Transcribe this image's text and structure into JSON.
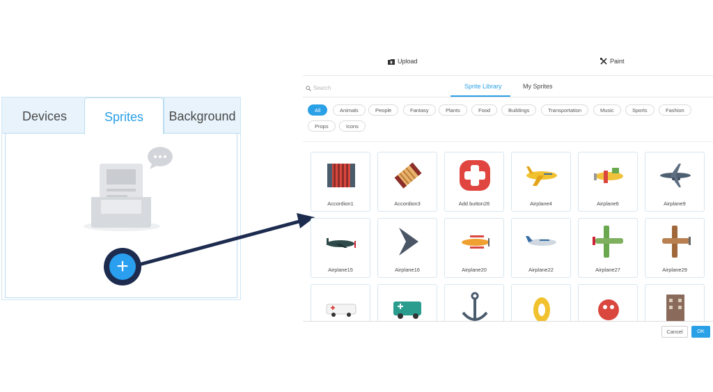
{
  "left_panel": {
    "tabs": [
      "Devices",
      "Sprites",
      "Background"
    ],
    "add_symbol": "+"
  },
  "dialog": {
    "upload_label": "Upload",
    "paint_label": "Paint",
    "search_placeholder": "Search",
    "library_tab": "Sprite Library",
    "my_tab": "My Sprites",
    "categories": [
      "All",
      "Animals",
      "People",
      "Fantasy",
      "Plants",
      "Food",
      "Buildings",
      "Transportation",
      "Music",
      "Sports",
      "Fashion",
      "Props",
      "Icons"
    ],
    "active_category": "All",
    "sprites": [
      "Accordion1",
      "Accordion3",
      "Add button26",
      "Airplane4",
      "Airplane6",
      "Airplane9",
      "Airplane15",
      "Airplane16",
      "Airplane20",
      "Airplane22",
      "Airplane27",
      "Airplane29"
    ],
    "cancel_label": "Cancel",
    "ok_label": "OK"
  },
  "colors": {
    "accent": "#2aa0e6",
    "arrow": "#1d2b4f"
  }
}
